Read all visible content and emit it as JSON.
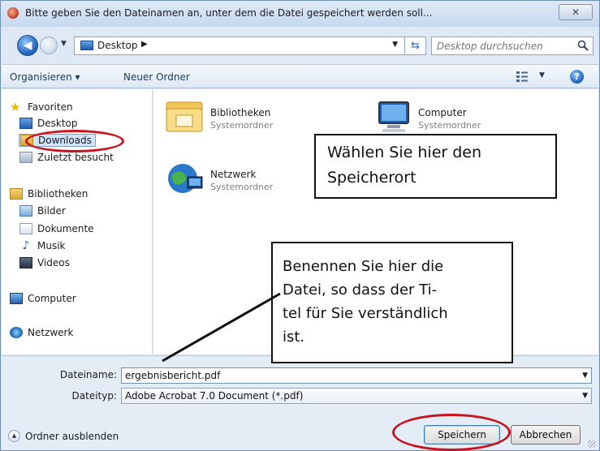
{
  "window": {
    "title": "Bitte geben Sie den Dateinamen an, unter dem die Datei gespeichert werden soll...",
    "close_glyph": "✕"
  },
  "address_bar": {
    "location": "Desktop",
    "search_placeholder": "Desktop durchsuchen"
  },
  "toolbar": {
    "organize_label": "Organisieren ▾",
    "new_folder_label": "Neuer Ordner",
    "help_glyph": "?"
  },
  "nav_pane": {
    "favorites_header": "Favoriten",
    "favorites": [
      "Desktop",
      "Downloads",
      "Zuletzt besucht"
    ],
    "libraries_header": "Bibliotheken",
    "libraries": [
      "Bilder",
      "Dokumente",
      "Musik",
      "Videos"
    ],
    "computer": "Computer",
    "network": "Netzwerk"
  },
  "content": {
    "items": [
      {
        "name": "Bibliotheken",
        "type": "Systemordner"
      },
      {
        "name": "Computer",
        "type": "Systemordner"
      },
      {
        "name": "Netzwerk",
        "type": "Systemordner"
      }
    ]
  },
  "callouts": {
    "location_lines": [
      "Wählen Sie hier den",
      "Speicherort"
    ],
    "filename_lines": [
      "Benennen Sie hier die",
      "Datei, so dass der Ti-",
      "tel für Sie verständlich",
      "ist."
    ]
  },
  "form": {
    "filename_label": "Dateiname:",
    "filename_value": "ergebnisbericht.pdf",
    "filetype_label": "Dateityp:",
    "filetype_value": "Adobe Acrobat 7.0 Document (*.pdf)",
    "hide_folders_label": "Ordner ausblenden",
    "save_label": "Speichern",
    "cancel_label": "Abbrechen"
  },
  "colors": {
    "highlight_ellipse": "#c8141e",
    "selected_item": "#cfe3fb"
  }
}
